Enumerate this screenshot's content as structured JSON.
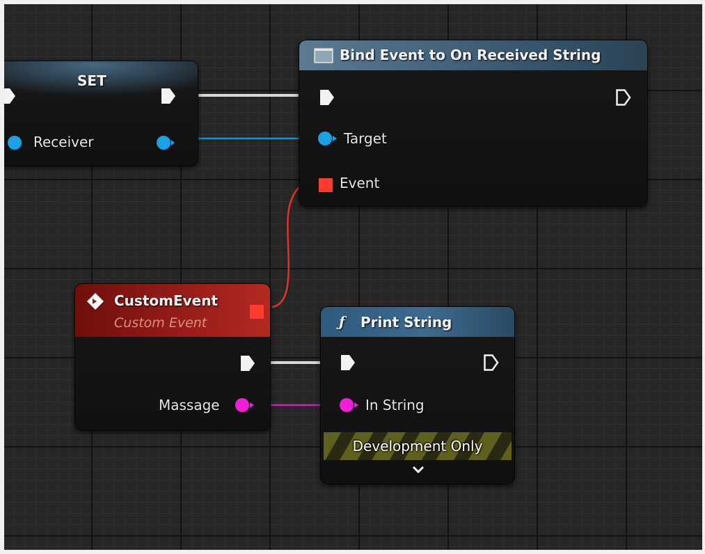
{
  "nodes": {
    "set": {
      "title": "SET",
      "receiver": "Receiver"
    },
    "bind": {
      "title": "Bind Event to On Received String",
      "target": "Target",
      "event": "Event"
    },
    "custom": {
      "title": "CustomEvent",
      "subtitle": "Custom Event",
      "massage": "Massage"
    },
    "print": {
      "title": "Print String",
      "in_string": "In String",
      "dev_only": "Development Only"
    }
  },
  "icons": {
    "function": "ƒ",
    "event_diamond": "event-diamond-icon",
    "bind_box": "delegate-box-icon",
    "expand": "chevron-down-icon"
  },
  "colors": {
    "exec": "#f2f2f2",
    "object_pin": "#1aa1e6",
    "delegate_pin": "#ff3a2e",
    "string_pin": "#f21ed9",
    "event_header": "#8f1a15",
    "function_header": "#3a6a8e"
  }
}
